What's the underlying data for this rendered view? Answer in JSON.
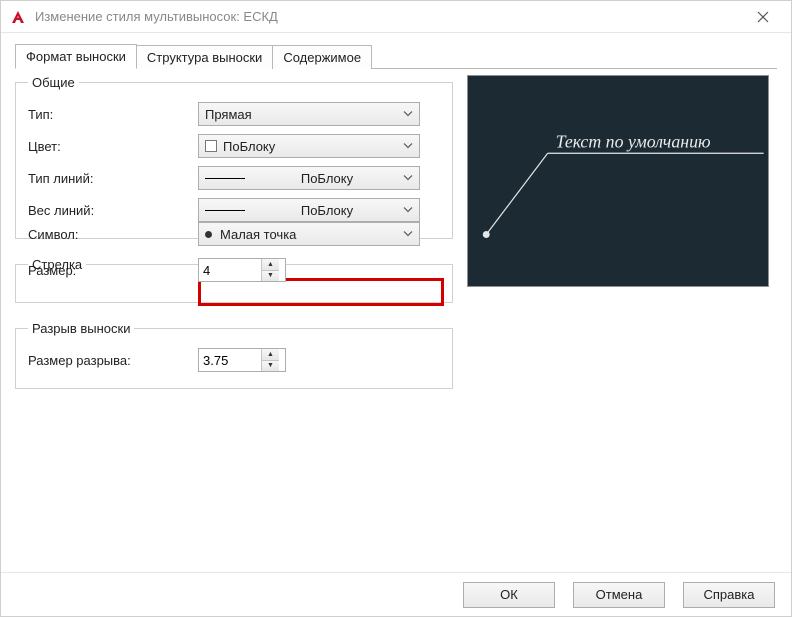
{
  "window": {
    "title": "Изменение стиля мультивыносок: ЕСКД"
  },
  "tabs": {
    "format": "Формат выноски",
    "structure": "Структура выноски",
    "content": "Содержимое"
  },
  "groups": {
    "general": {
      "legend": "Общие",
      "type_label": "Тип:",
      "type_value": "Прямая",
      "color_label": "Цвет:",
      "color_value": "ПоБлоку",
      "linetype_label": "Тип линий:",
      "linetype_value": "ПоБлоку",
      "lineweight_label": "Вес линий:",
      "lineweight_value": "ПоБлоку"
    },
    "arrow": {
      "legend": "Стрелка",
      "symbol_label": "Символ:",
      "symbol_value": "Малая точка",
      "size_label": "Размер:",
      "size_value": "4"
    },
    "break": {
      "legend": "Разрыв выноски",
      "size_label": "Размер разрыва:",
      "size_value": "3.75"
    }
  },
  "preview": {
    "text": "Текст по умолчанию"
  },
  "buttons": {
    "ok": "ОК",
    "cancel": "Отмена",
    "help": "Справка"
  }
}
